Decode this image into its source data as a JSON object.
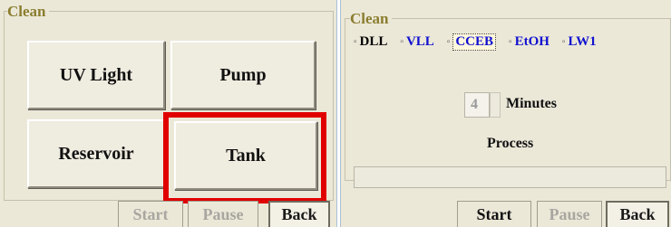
{
  "left_panel": {
    "title": "Clean",
    "buttons": {
      "uv_light": "UV Light",
      "pump": "Pump",
      "reservoir": "Reservoir",
      "tank": "Tank"
    },
    "footer": {
      "start": "Start",
      "pause": "Pause",
      "back": "Back"
    }
  },
  "right_panel": {
    "title": "Clean",
    "options": [
      {
        "label": "DLL",
        "color": "#111111",
        "selected": false
      },
      {
        "label": "VLL",
        "color": "#1010d0",
        "selected": false
      },
      {
        "label": "CCEB",
        "color": "#1010d0",
        "selected": true
      },
      {
        "label": "EtOH",
        "color": "#1010d0",
        "selected": false
      },
      {
        "label": "LW1",
        "color": "#1010d0",
        "selected": false
      }
    ],
    "minutes_value": "4",
    "minutes_label": "Minutes",
    "process_label": "Process",
    "footer": {
      "start": "Start",
      "pause": "Pause",
      "back": "Back"
    }
  },
  "colors": {
    "highlight": "#e00000",
    "legend": "#8b7d2f",
    "option_blue": "#1010d0"
  }
}
